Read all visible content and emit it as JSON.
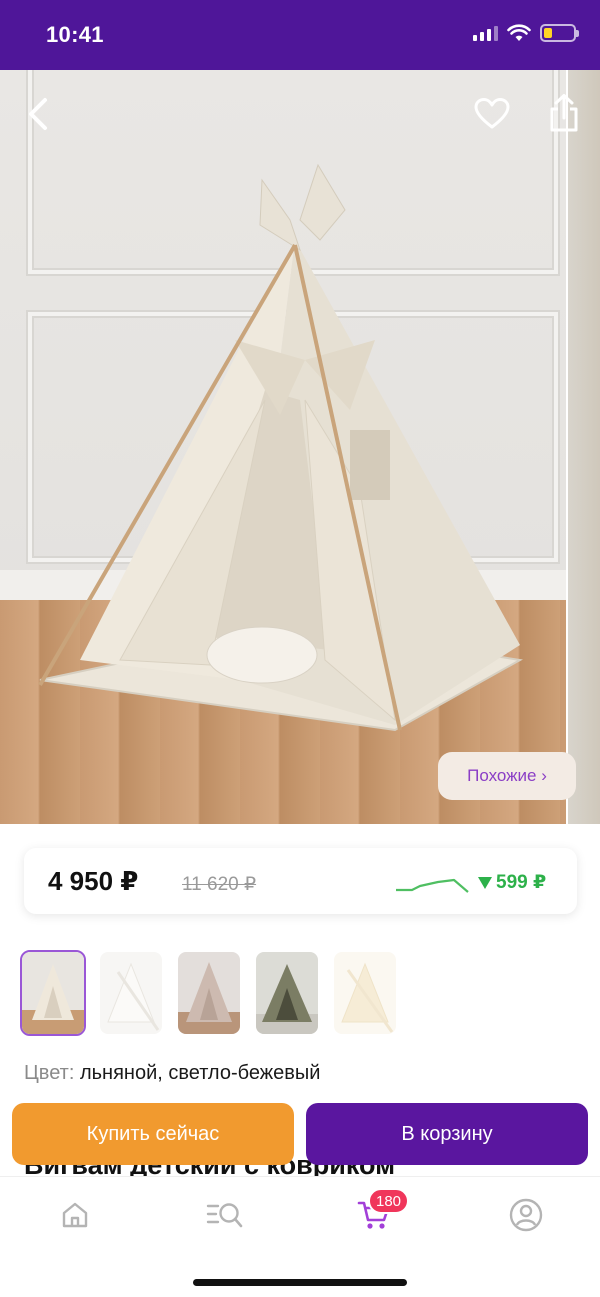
{
  "status": {
    "time": "10:41",
    "battery_level": 0.3,
    "battery_color": "#ffd426"
  },
  "header": {
    "back_icon": "chevron-left-icon",
    "favorite_icon": "heart-icon",
    "share_icon": "share-icon"
  },
  "gallery": {
    "similar_label": "Похожие ›"
  },
  "price": {
    "current": "4 950 ₽",
    "old": "11 620 ₽",
    "drop": "599 ₽",
    "drop_color": "#2db14a"
  },
  "thumbnails": [
    "thumb-1",
    "thumb-2",
    "thumb-3",
    "thumb-4",
    "thumb-5"
  ],
  "color": {
    "label": "Цвет:",
    "value": "льняной, светло-бежевый"
  },
  "product": {
    "title": "Вигвам детский с ковриком"
  },
  "actions": {
    "buy_now": "Купить сейчас",
    "add_to_cart": "В корзину"
  },
  "tabbar": {
    "cart_badge": "180",
    "accent": "#a23fd8"
  },
  "colors": {
    "brand": "#4f1699",
    "cart_button": "#5a169f",
    "buy_button": "#f19a2f",
    "badge": "#f0365b"
  }
}
